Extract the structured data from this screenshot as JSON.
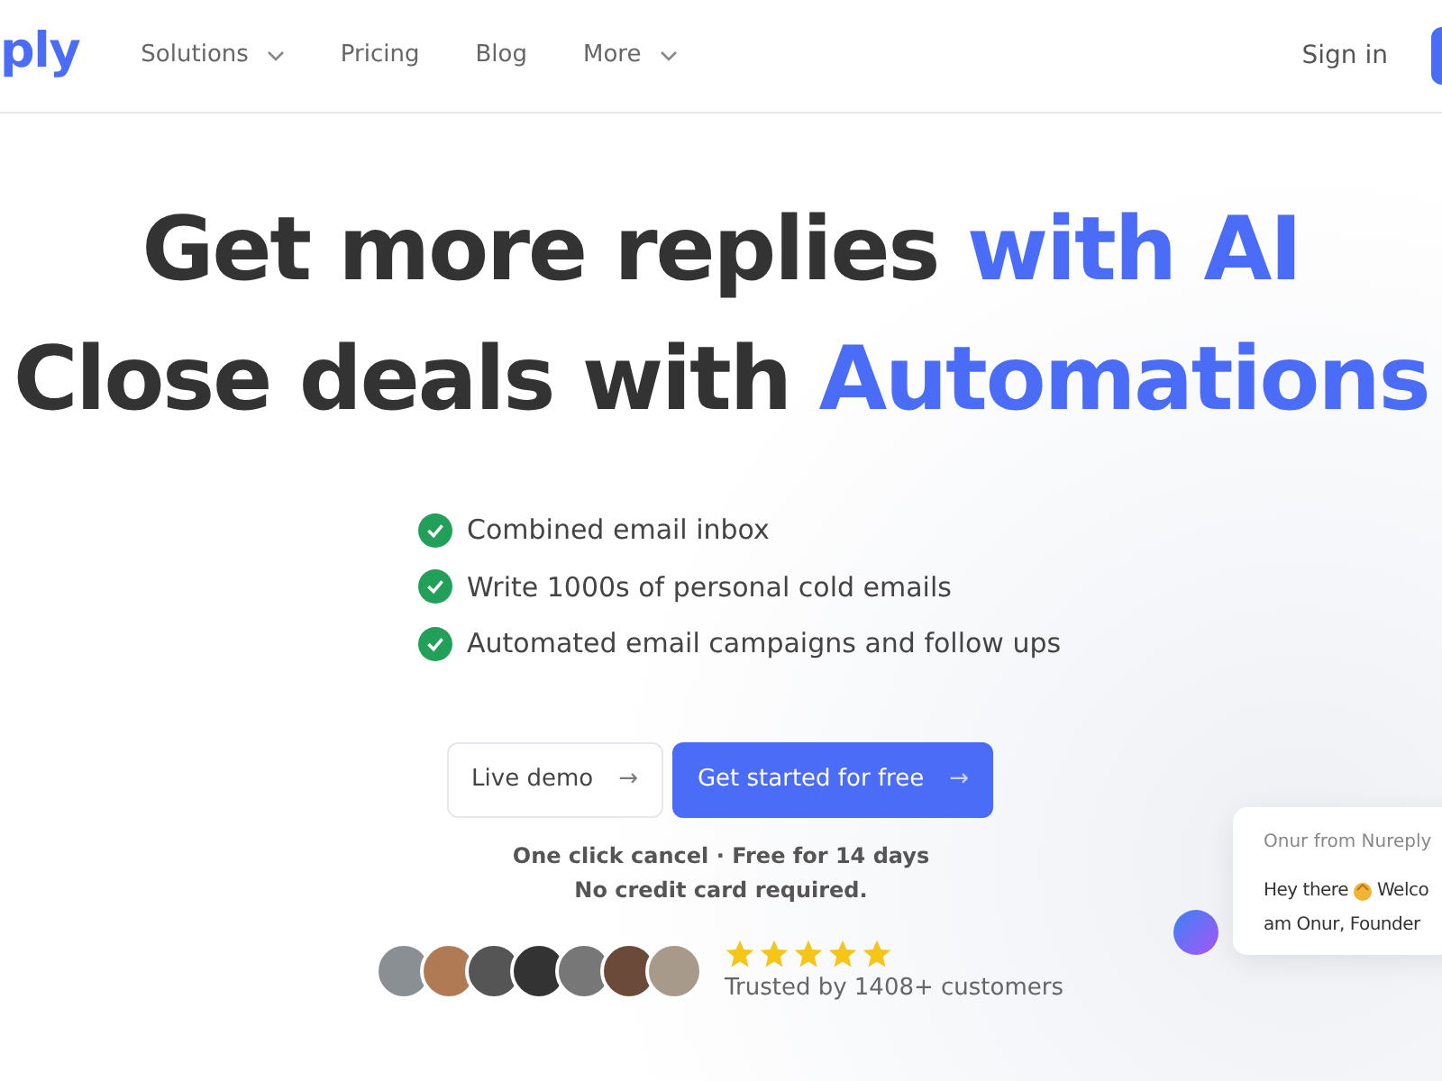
{
  "nav": {
    "logo": "ply",
    "items": [
      {
        "label": "Solutions",
        "dropdown": true
      },
      {
        "label": "Pricing",
        "dropdown": false
      },
      {
        "label": "Blog",
        "dropdown": false
      },
      {
        "label": "More",
        "dropdown": true
      }
    ],
    "sign_in": "Sign in"
  },
  "hero": {
    "lines": [
      [
        {
          "text": "Get more replies ",
          "accent": false
        },
        {
          "text": "with AI",
          "accent": true
        }
      ],
      [
        {
          "text": "Close deals with ",
          "accent": false
        },
        {
          "text": "Automations",
          "accent": true
        }
      ]
    ],
    "features": [
      "Combined email inbox",
      "Write 1000s of personal cold emails",
      "Automated email campaigns and follow ups"
    ],
    "buttons": [
      {
        "label": "Live demo",
        "kind": "secondary",
        "arrow": "→"
      },
      {
        "label": "Get started for free",
        "kind": "primary",
        "arrow": "→"
      }
    ],
    "notes": [
      "One click cancel · Free for 14 days",
      "No credit card required."
    ],
    "stars": 5,
    "trusted": "Trusted by 1408+ customers"
  },
  "chat": {
    "sender": "Onur from Nureply",
    "line_1_start": "Hey there",
    "line_1_end": "Welco",
    "line_2": "am Onur, Founder"
  }
}
